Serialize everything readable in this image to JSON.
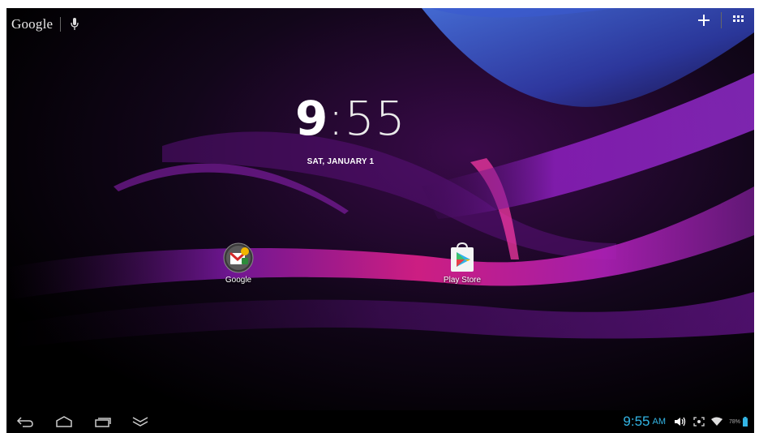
{
  "topbar": {
    "search_logo": "Google",
    "icons": {
      "mic": "mic-icon",
      "add": "add-icon",
      "apps": "apps-grid-icon"
    }
  },
  "clock": {
    "hour": "9",
    "separator": ":",
    "minute": "55",
    "date": "SAT, JANUARY 1"
  },
  "desktop": {
    "icons": [
      {
        "label": "Google",
        "icon": "google-folder-icon"
      },
      {
        "label": "Play Store",
        "icon": "play-store-icon"
      }
    ]
  },
  "navbar": {
    "buttons": [
      "back-icon",
      "home-icon",
      "recent-apps-icon",
      "hide-keyboard-icon"
    ]
  },
  "status": {
    "time": "9:55",
    "ampm": "AM",
    "battery_percent": "78%",
    "icons": [
      "volume-icon",
      "screenshot-icon",
      "wifi-icon",
      "battery-icon"
    ]
  },
  "colors": {
    "accent": "#33b5e5",
    "wallpaper_purple": "#a020c8",
    "wallpaper_pink": "#e0208c",
    "wallpaper_blue": "#3a6ad8"
  }
}
